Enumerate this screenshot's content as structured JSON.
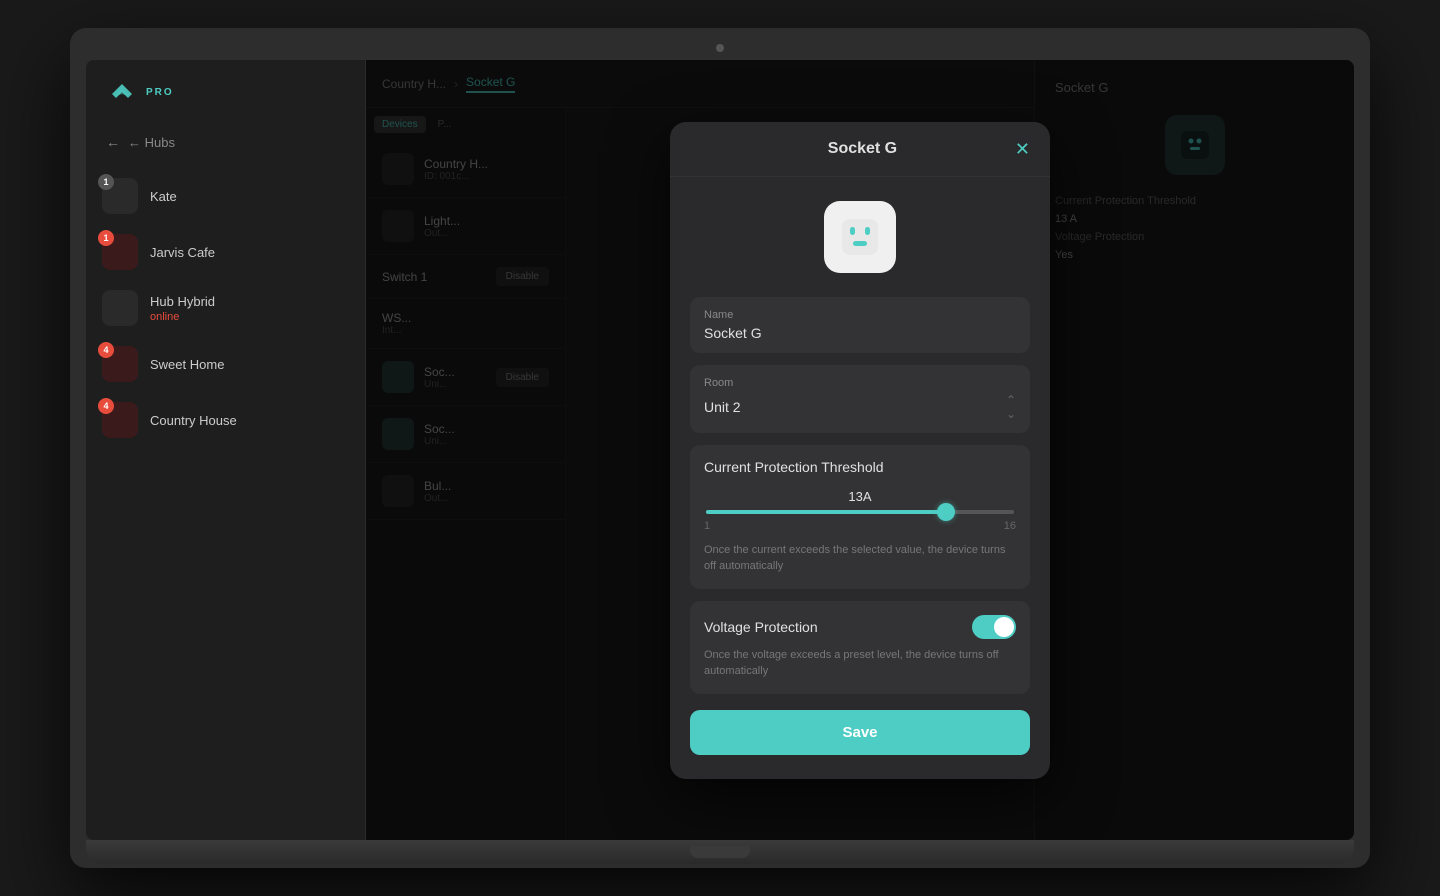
{
  "app": {
    "title": "PRO"
  },
  "sidebar": {
    "back_label": "← Hubs",
    "hubs_title": "Hubs",
    "items": [
      {
        "name": "Kate",
        "sub": "",
        "badge": "1",
        "badge_type": "gray"
      },
      {
        "name": "Jarvis Cafe",
        "sub": "",
        "badge": "1",
        "badge_type": "red"
      },
      {
        "name": "Hub Hybrid",
        "sub": "online",
        "badge": "",
        "badge_type": ""
      },
      {
        "name": "Sweet Home",
        "sub": "",
        "badge": "4",
        "badge_type": "red"
      },
      {
        "name": "Country House",
        "sub": "",
        "badge": "4",
        "badge_type": "red"
      }
    ]
  },
  "device_list": {
    "items": [
      {
        "name": "Country H...",
        "sub": "ID: 001c...",
        "action": ""
      },
      {
        "name": "Light...",
        "sub": "Out...",
        "action": ""
      },
      {
        "name": "Switch 1",
        "sub": "",
        "action": "Disable"
      },
      {
        "name": "WS...",
        "sub": "Int...",
        "action": ""
      },
      {
        "name": "Soc...",
        "sub": "Uni...",
        "action": "Disable"
      },
      {
        "name": "Soc...",
        "sub": "Uni...",
        "action": ""
      },
      {
        "name": "Bul...",
        "sub": "Out...",
        "action": ""
      }
    ]
  },
  "modal": {
    "title": "Socket G",
    "close_icon": "✕",
    "device_name_label": "Name",
    "device_name_value": "Socket G",
    "room_label": "Room",
    "room_value": "Unit 2",
    "current_protection_title": "Current Protection Threshold",
    "slider_value": "13A",
    "slider_min": "1",
    "slider_max": "16",
    "slider_percent": 78,
    "current_desc": "Once the current exceeds the selected value, the device turns off automatically",
    "voltage_title": "Voltage Protection",
    "voltage_toggle": true,
    "voltage_desc": "Once the voltage exceeds a preset level, the device turns off automatically",
    "save_label": "Save"
  },
  "right_panel": {
    "title": "Socket G"
  },
  "colors": {
    "accent": "#4ecdc4",
    "danger": "#e74c3c"
  }
}
